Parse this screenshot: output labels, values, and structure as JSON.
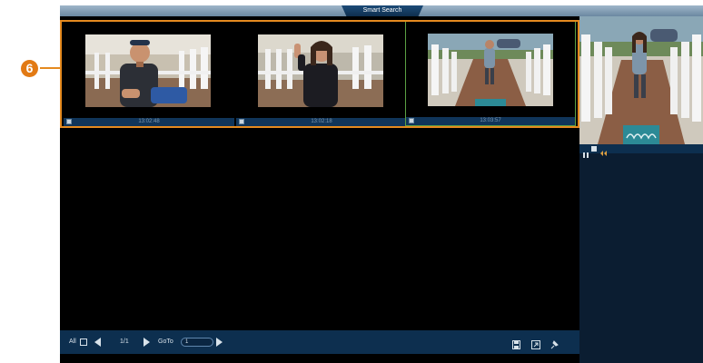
{
  "title": "Smart Search",
  "callout": "6",
  "clips": [
    {
      "time": "13:02:48",
      "selected": false
    },
    {
      "time": "13:02:18",
      "selected": false
    },
    {
      "time": "13:03:57",
      "selected": true
    }
  ],
  "pager": {
    "all_label": "All",
    "page": "1/1",
    "goto_label": "GoTo",
    "goto_value": "1"
  },
  "colors": {
    "accent": "#e58a1f",
    "selection": "#5aa043",
    "toolbar": "#0d2f4f"
  },
  "icons": [
    "checkbox-icon",
    "prev-page-icon",
    "next-page-icon",
    "go-icon",
    "save-icon",
    "export-icon",
    "pin-icon",
    "pause-icon",
    "stop-icon",
    "rewind-icon"
  ]
}
